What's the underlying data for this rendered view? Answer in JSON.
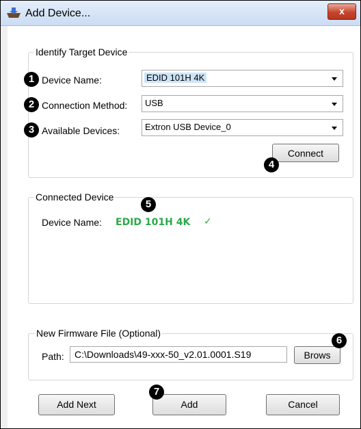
{
  "window": {
    "title": "Add Device...",
    "close_label": "x"
  },
  "identify": {
    "group_label": "Identify Target Device",
    "device_name": {
      "label": "Device Name:",
      "value": "EDID 101H 4K"
    },
    "connection_method": {
      "label": "Connection Method:",
      "value": "USB"
    },
    "available_devices": {
      "label": "Available Devices:",
      "value": "Extron USB Device_0"
    },
    "connect_label": "Connect"
  },
  "connected": {
    "group_label": "Connected Device",
    "device_name_label": "Device Name:",
    "device_name_value": "EDID 101H 4K",
    "status_mark": "✓",
    "status_color": "#2da84a"
  },
  "firmware": {
    "group_label": "New Firmware File (Optional)",
    "path_label": "Path:",
    "path_value": "C:\\Downloads\\49-xxx-50_v2.01.0001.S19",
    "browse_label": "Brows"
  },
  "footer": {
    "add_next_label": "Add Next",
    "add_label": "Add",
    "cancel_label": "Cancel"
  },
  "callouts": [
    "1",
    "2",
    "3",
    "4",
    "5",
    "6",
    "7"
  ]
}
